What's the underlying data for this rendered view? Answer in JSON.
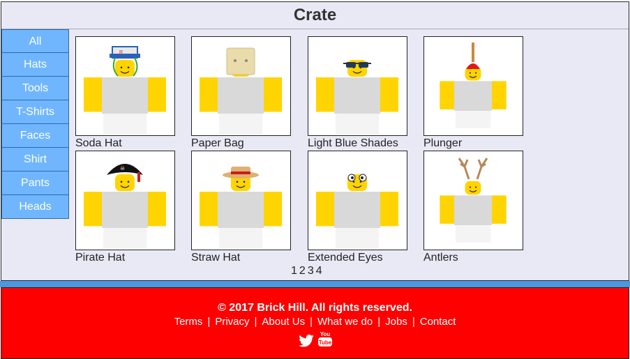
{
  "title": "Crate",
  "sidebar": {
    "items": [
      {
        "label": "All"
      },
      {
        "label": "Hats"
      },
      {
        "label": "Tools"
      },
      {
        "label": "T-Shirts"
      },
      {
        "label": "Faces"
      },
      {
        "label": "Shirt"
      },
      {
        "label": "Pants"
      },
      {
        "label": "Heads"
      }
    ]
  },
  "items": [
    {
      "name": "Soda Hat",
      "accessory": "soda-hat"
    },
    {
      "name": "Paper Bag",
      "accessory": "paper-bag"
    },
    {
      "name": "Light Blue Shades",
      "accessory": "shades"
    },
    {
      "name": "Plunger",
      "accessory": "plunger"
    },
    {
      "name": "Pirate Hat",
      "accessory": "pirate-hat"
    },
    {
      "name": "Straw Hat",
      "accessory": "straw-hat"
    },
    {
      "name": "Extended Eyes",
      "accessory": "extended-eyes"
    },
    {
      "name": "Antlers",
      "accessory": "antlers"
    }
  ],
  "pager": {
    "pages": [
      "1",
      "2",
      "3",
      "4"
    ]
  },
  "footer": {
    "copyright": "© 2017 Brick Hill. All rights reserved.",
    "links": [
      "Terms",
      "Privacy",
      "About Us",
      "What we do",
      "Jobs",
      "Contact"
    ],
    "social": [
      "twitter-icon",
      "youtube-icon"
    ]
  },
  "colors": {
    "sidebar_bg": "#6fb6ff",
    "footer_bg": "#ff0000",
    "band": "#4a98e0",
    "panel_bg": "#e9e9f5",
    "avatar_yellow": "#ffd400",
    "avatar_gray": "#d9d9d9"
  }
}
